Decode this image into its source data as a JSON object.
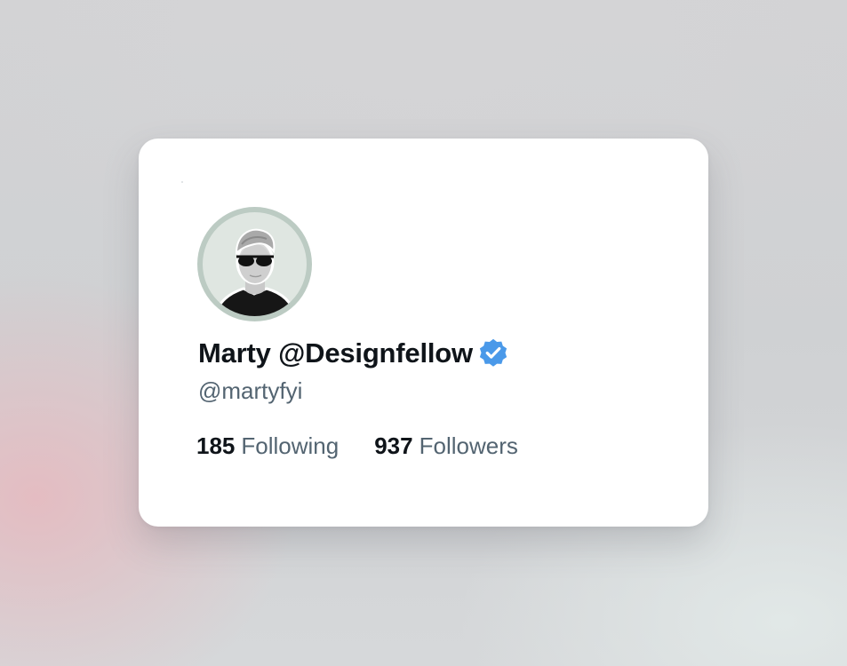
{
  "profile": {
    "display_name": "Marty @Designfellow",
    "handle": "@martyfyi",
    "verified": true,
    "verified_badge_color": "#4a99e9",
    "avatar_ring_color": "#bccbc3"
  },
  "stats": {
    "following": {
      "count": "185",
      "label": "Following"
    },
    "followers": {
      "count": "937",
      "label": "Followers"
    }
  }
}
